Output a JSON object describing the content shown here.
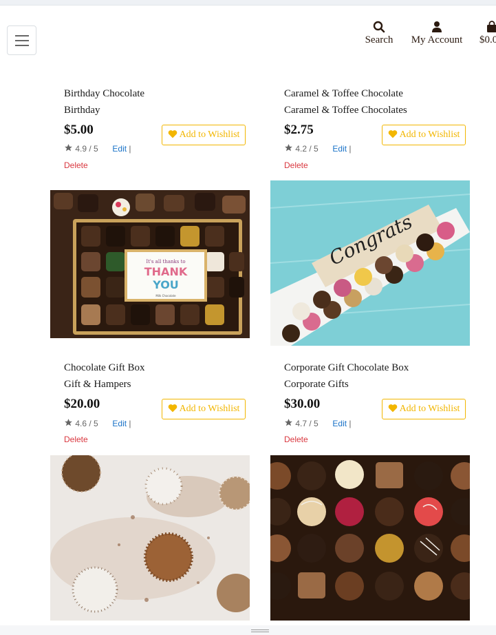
{
  "header": {
    "search_label": "Search",
    "account_label": "My Account",
    "cart_label": "$0.0"
  },
  "icons": [
    "menu-icon",
    "search-icon",
    "user-icon",
    "cart-icon",
    "star-icon",
    "heart-icon"
  ],
  "colors": {
    "wishlist": "#f2b600",
    "edit_link": "#1a73c8",
    "delete_link": "#d9363e"
  },
  "products": [
    {
      "name": "Birthday Chocolate",
      "category": "Birthday",
      "price": "$5.00",
      "rating": "4.9 / 5",
      "edit": "Edit",
      "sep": "|",
      "delete": "Delete",
      "wishlist": "Add to Wishlist"
    },
    {
      "name": "Caramel & Toffee Chocolate",
      "category": "Caramel & Toffee Chocolates",
      "price": "$2.75",
      "rating": "4.2 / 5",
      "edit": "Edit",
      "sep": "|",
      "delete": "Delete",
      "wishlist": "Add to Wishlist"
    },
    {
      "name": "Chocolate Gift Box",
      "category": "Gift & Hampers",
      "price": "$20.00",
      "rating": "4.6 / 5",
      "edit": "Edit",
      "sep": "|",
      "delete": "Delete",
      "wishlist": "Add to Wishlist",
      "image_text": [
        "It's all thanks to",
        "THANK",
        "YOU",
        "Milk Chocolate"
      ]
    },
    {
      "name": "Corporate Gift Chocolate Box",
      "category": "Corporate Gifts",
      "price": "$30.00",
      "rating": "4.7 / 5",
      "edit": "Edit",
      "sep": "|",
      "delete": "Delete",
      "wishlist": "Add to Wishlist",
      "image_text": [
        "Congrats"
      ]
    },
    {
      "name": "",
      "category": "",
      "price": ""
    },
    {
      "name": "",
      "category": "",
      "price": ""
    }
  ]
}
